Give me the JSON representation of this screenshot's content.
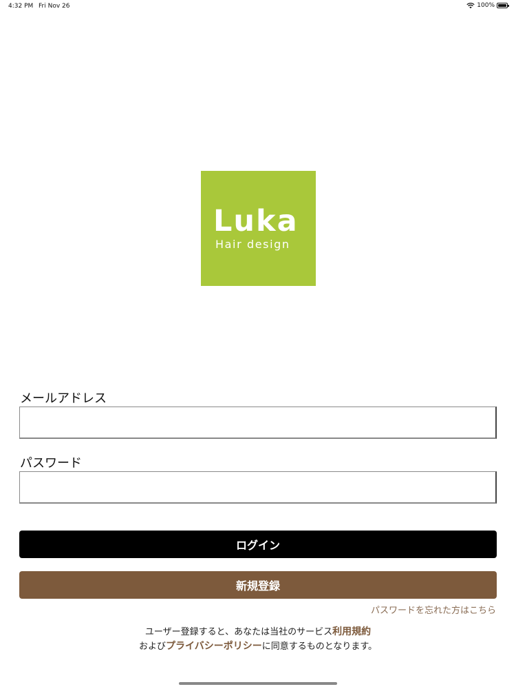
{
  "status_bar": {
    "time": "4:32 PM",
    "date": "Fri Nov 26",
    "battery": "100%"
  },
  "logo": {
    "word": "Luka",
    "subtitle": "Hair design",
    "bg_color": "#a9c83a"
  },
  "form": {
    "email_label": "メールアドレス",
    "email_value": "",
    "password_label": "パスワード",
    "password_value": ""
  },
  "buttons": {
    "login_label": "ログイン",
    "login_color": "#000000",
    "register_label": "新規登録",
    "register_color": "#7d5a3c"
  },
  "forgot_password": "パスワードを忘れた方はこちら",
  "terms": {
    "line1_prefix": "ユーザー登録すると、あなたは当社のサービス",
    "terms_link": "利用規約",
    "line2_prefix": "および",
    "privacy_link": "プライバシーポリシー",
    "line2_suffix": "に同意するものとなります。"
  }
}
